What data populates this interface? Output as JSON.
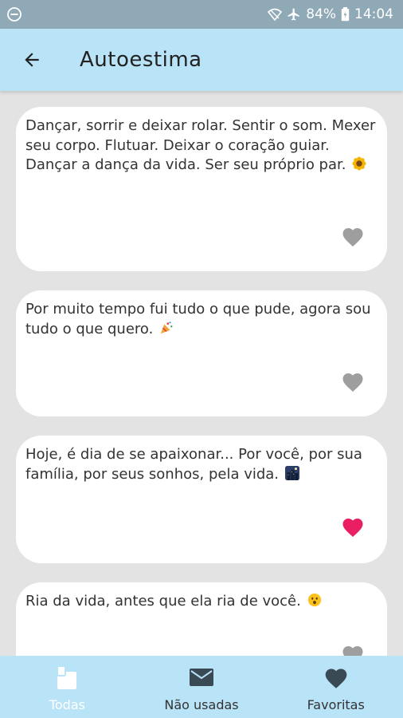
{
  "status_bar": {
    "battery": "84%",
    "time": "14:04"
  },
  "header": {
    "title": "Autoestima",
    "back_icon": "arrow-left-icon"
  },
  "quotes": [
    {
      "text": "Dançar, sorrir e deixar rolar. Sentir o som. Mexer seu corpo. Flutuar. Deixar o coração guiar. Dançar a dança da vida. Ser seu próprio par.",
      "emoji": "sunflower",
      "favorite": false
    },
    {
      "text": "Por muito tempo fui tudo o que pude, agora sou tudo o que quero.",
      "emoji": "party-popper",
      "favorite": false
    },
    {
      "text": "Hoje, é dia de se apaixonar... Por você, por sua família, por seus sonhos, pela vida.",
      "emoji": "night-city",
      "favorite": true
    },
    {
      "text": "Ria da vida, antes que ela ria de você.",
      "emoji": "surprised-face",
      "favorite": false
    }
  ],
  "bottom_nav": {
    "todas": "Todas",
    "nao_usadas": "Não usadas",
    "favoritas": "Favoritas"
  },
  "colors": {
    "status_bar": "#8fa9b6",
    "app_bar": "#b9e3f6",
    "background": "#e3e3e3",
    "heart_inactive": "#9e9e9e",
    "heart_active": "#e91e63"
  }
}
